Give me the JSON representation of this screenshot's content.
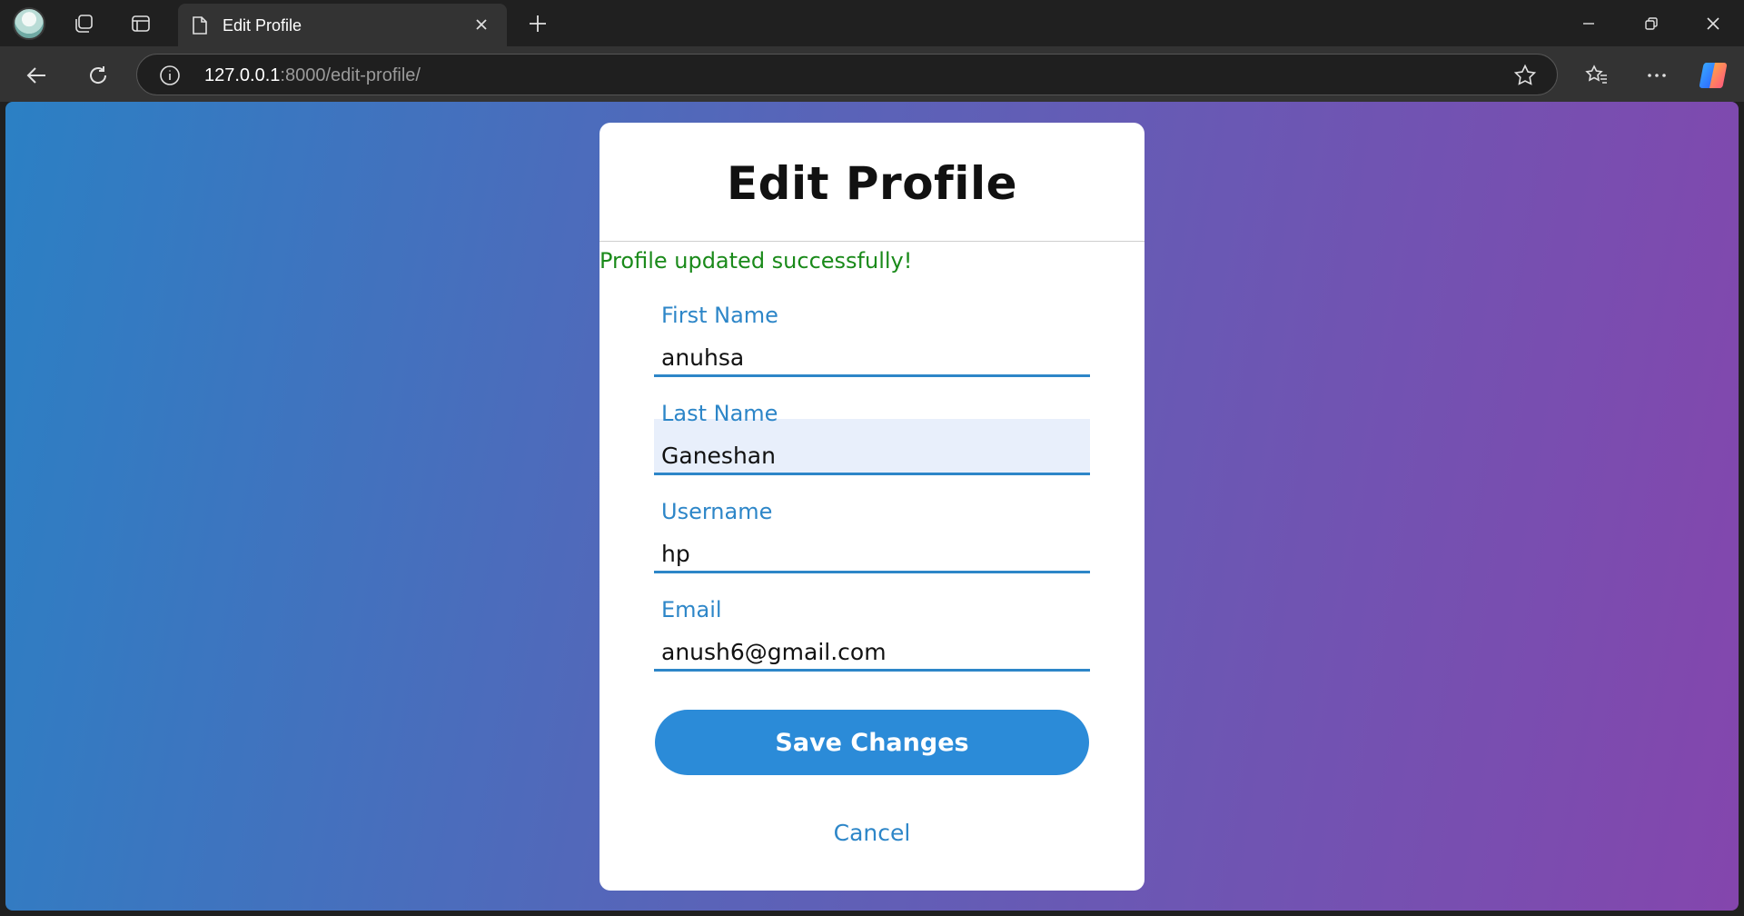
{
  "browser": {
    "tab_title": "Edit Profile",
    "url_host": "127.0.0.1",
    "url_rest": ":8000/edit-profile/"
  },
  "page": {
    "title": "Edit Profile",
    "success_message": "Profile updated successfully!",
    "fields": [
      {
        "label": "First Name",
        "value": "anuhsa"
      },
      {
        "label": "Last Name",
        "value": "Ganeshan"
      },
      {
        "label": "Username",
        "value": "hp"
      },
      {
        "label": "Email",
        "value": "anush6@gmail.com"
      }
    ],
    "save_label": "Save Changes",
    "cancel_label": "Cancel"
  },
  "colors": {
    "accent": "#2b8bd8",
    "success": "#1a8a1a",
    "gradient_start": "#2b80c4",
    "gradient_end": "#8446ad"
  }
}
